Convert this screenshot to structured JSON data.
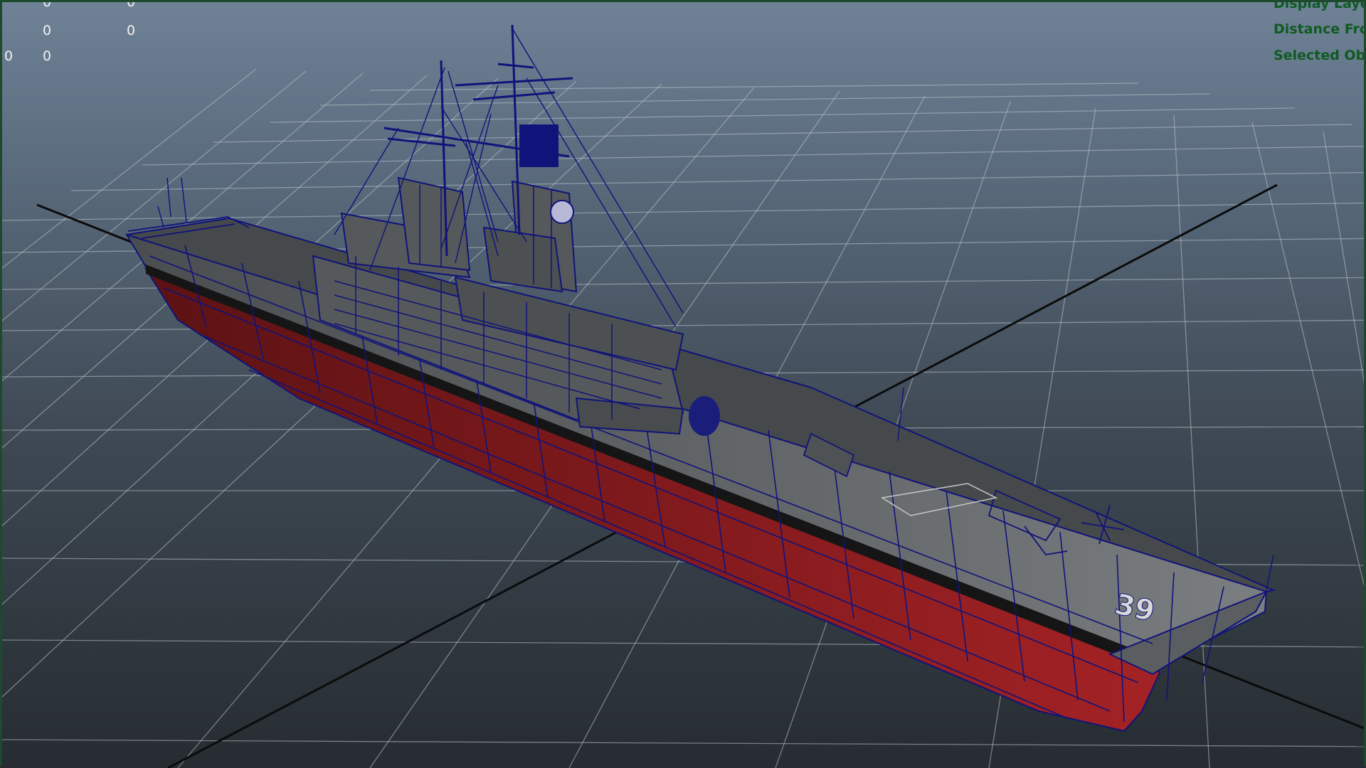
{
  "hud": {
    "left_stats": [
      [
        "0",
        "0"
      ],
      [
        "0",
        "0"
      ],
      [
        "0",
        "0",
        "0"
      ]
    ],
    "right_labels": [
      "Display Laye",
      "Distance Fro",
      "Selected Obj"
    ]
  },
  "model": {
    "hull_number": "39"
  },
  "colors": {
    "wireframe": "#10137a",
    "hull_bottom": "#8c1c1e",
    "hull_side": "#5a5e60",
    "deck": "#464a4c",
    "grid": "#b9c2c8",
    "axis": "#0b0b0b",
    "hud_label": "#0f5a22"
  }
}
